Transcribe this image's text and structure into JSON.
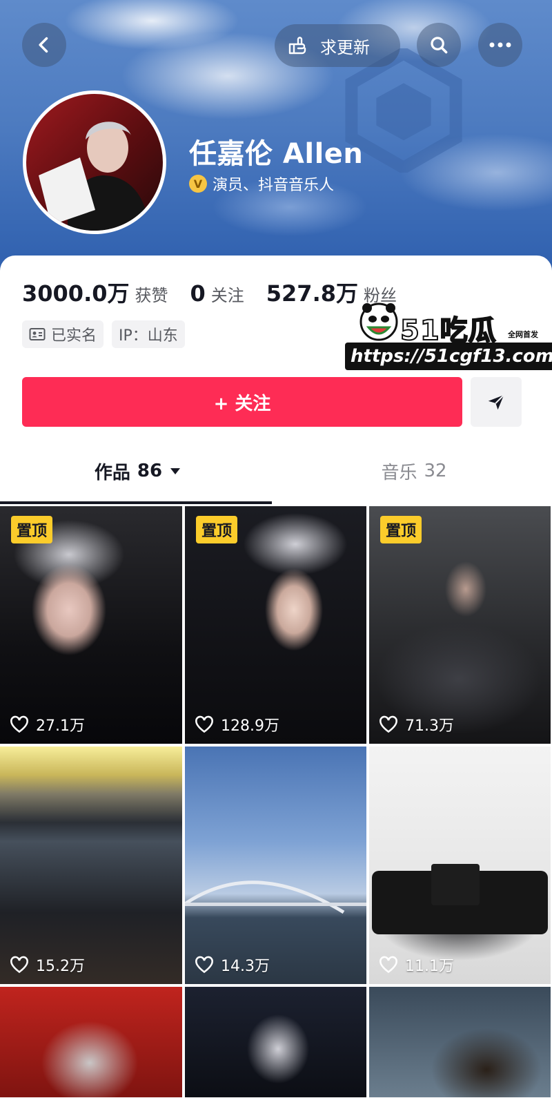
{
  "header": {
    "update_label": "求更新",
    "colors": {
      "cover_top": "#5f8bcb",
      "cover_bottom": "#2e5fae"
    }
  },
  "profile": {
    "name": "任嘉伦 Allen",
    "verification": "演员、抖音音乐人",
    "verification_badge": "V"
  },
  "stats": [
    {
      "value": "3000.0万",
      "label": "获赞"
    },
    {
      "value": "0",
      "label": "关注"
    },
    {
      "value": "527.8万",
      "label": "粉丝"
    }
  ],
  "tags": [
    {
      "icon": "id-card-icon",
      "label": "已实名"
    },
    {
      "label": "IP：山东"
    }
  ],
  "actions": {
    "follow_label": "+ 关注",
    "follow_color": "#fe2c55"
  },
  "tabs": [
    {
      "label": "作品",
      "count": "86",
      "active": true
    },
    {
      "label": "音乐",
      "count": "32",
      "active": false
    }
  ],
  "watermark": {
    "brand": "51吃瓜",
    "sub": "全网首发",
    "url": "https://51cgf13.com"
  },
  "videos": [
    {
      "pinned": true,
      "pin_label": "置顶",
      "likes": "27.1万"
    },
    {
      "pinned": true,
      "pin_label": "置顶",
      "likes": "128.9万"
    },
    {
      "pinned": true,
      "pin_label": "置顶",
      "likes": "71.3万"
    },
    {
      "pinned": false,
      "likes": "15.2万"
    },
    {
      "pinned": false,
      "likes": "14.3万"
    },
    {
      "pinned": false,
      "likes": "11.1万"
    },
    {
      "pinned": false
    },
    {
      "pinned": false
    },
    {
      "pinned": false
    }
  ]
}
